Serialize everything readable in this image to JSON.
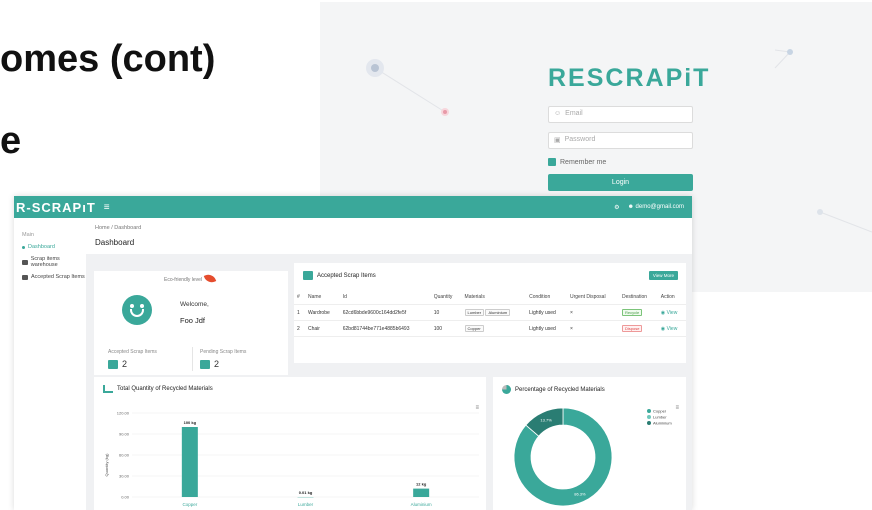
{
  "slide": {
    "title_partial": "omes (cont)",
    "subtitle_partial": "e"
  },
  "login": {
    "brand": "RESCRAPiT",
    "email_placeholder": "Email",
    "password_placeholder": "Password",
    "remember_label": "Remember me",
    "login_button": "Login"
  },
  "dashboard": {
    "topbar": {
      "logo": "R-SCRAPıT",
      "menu_icon": "menu-icon",
      "settings_icon": "gear-icon",
      "user_email": "demo@gmail.com"
    },
    "sidebar": {
      "section": "Main",
      "items": [
        {
          "label": "Dashboard",
          "active": true
        },
        {
          "label": "Scrap items warehouse",
          "active": false
        },
        {
          "label": "Accepted Scrap Items",
          "active": false
        }
      ]
    },
    "breadcrumb": {
      "home": "Home",
      "sep": "/",
      "current": "Dashboard"
    },
    "page_title": "Dashboard",
    "eco_card": {
      "label": "Eco-friendly level",
      "welcome": "Welcome,",
      "user_name": "Foo Jdf",
      "accepted_label": "Accepted Scrap Items",
      "accepted_count": "2",
      "pending_label": "Pending Scrap Items",
      "pending_count": "2"
    },
    "accepted_table": {
      "title": "Accepted Scrap Items",
      "view_more": "View More",
      "columns": [
        "#",
        "Name",
        "Id",
        "Quantity",
        "Materials",
        "Condition",
        "Urgent Disposal",
        "Destination",
        "Action"
      ],
      "rows": [
        {
          "num": "1",
          "name": "Wardrobe",
          "id": "62cd6bbde9600c164dd2fe5f",
          "quantity": "10",
          "materials": [
            "Lumber",
            "Aluminium"
          ],
          "condition": "Lightly used",
          "urgent": "×",
          "destination": "Recycle",
          "action": "View"
        },
        {
          "num": "2",
          "name": "Chair",
          "id": "62bd81744be771e4885b6493",
          "quantity": "100",
          "materials": [
            "Copper"
          ],
          "condition": "Lightly used",
          "urgent": "×",
          "destination": "Dispose",
          "action": "View"
        }
      ]
    },
    "colors": {
      "accent": "#3aa89a",
      "recycle": "#4a9c48",
      "dispose": "#dd4444"
    }
  },
  "chart_data": [
    {
      "type": "bar",
      "title": "Total Quantity of Recycled Materials",
      "ylabel": "Quantity (kg)",
      "categories": [
        "Copper",
        "Lumber",
        "Aluminium"
      ],
      "values": [
        100,
        0.01,
        12
      ],
      "data_labels": [
        "100 kg",
        "0.01 kg",
        "12 kg"
      ],
      "y_ticks": [
        "120.00",
        "90.00",
        "60.00",
        "30.00",
        "0.00"
      ],
      "ylim": [
        0,
        120
      ],
      "color": "#3aa89a",
      "grid": true
    },
    {
      "type": "pie",
      "title": "Percentage of Recycled Materials",
      "categories": [
        "Copper",
        "Lumber",
        "Aluminium"
      ],
      "values": [
        86.3,
        0.0,
        13.7
      ],
      "labels": [
        "86.3%",
        "13.7%"
      ],
      "colors": [
        "#3aa89a",
        "#6fc8bc",
        "#2a7d73"
      ],
      "legend": "top-right"
    }
  ]
}
